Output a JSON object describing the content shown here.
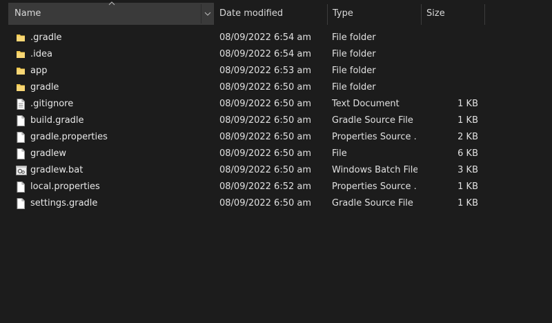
{
  "header": {
    "name": "Name",
    "date_modified": "Date modified",
    "type": "Type",
    "size": "Size"
  },
  "files": [
    {
      "name": ".gradle",
      "date": "08/09/2022 6:54 am",
      "type": "File folder",
      "size": "",
      "icon": "folder-icon"
    },
    {
      "name": ".idea",
      "date": "08/09/2022 6:54 am",
      "type": "File folder",
      "size": "",
      "icon": "folder-icon"
    },
    {
      "name": "app",
      "date": "08/09/2022 6:53 am",
      "type": "File folder",
      "size": "",
      "icon": "folder-icon"
    },
    {
      "name": "gradle",
      "date": "08/09/2022 6:50 am",
      "type": "File folder",
      "size": "",
      "icon": "folder-icon"
    },
    {
      "name": ".gitignore",
      "date": "08/09/2022 6:50 am",
      "type": "Text Document",
      "size": "1 KB",
      "icon": "text-file-icon"
    },
    {
      "name": "build.gradle",
      "date": "08/09/2022 6:50 am",
      "type": "Gradle Source File",
      "size": "1 KB",
      "icon": "file-icon"
    },
    {
      "name": "gradle.properties",
      "date": "08/09/2022 6:50 am",
      "type": "Properties Source ...",
      "size": "2 KB",
      "icon": "file-icon"
    },
    {
      "name": "gradlew",
      "date": "08/09/2022 6:50 am",
      "type": "File",
      "size": "6 KB",
      "icon": "file-icon"
    },
    {
      "name": "gradlew.bat",
      "date": "08/09/2022 6:50 am",
      "type": "Windows Batch File",
      "size": "3 KB",
      "icon": "batch-file-icon"
    },
    {
      "name": "local.properties",
      "date": "08/09/2022 6:52 am",
      "type": "Properties Source ...",
      "size": "1 KB",
      "icon": "file-icon"
    },
    {
      "name": "settings.gradle",
      "date": "08/09/2022 6:50 am",
      "type": "Gradle Source File",
      "size": "1 KB",
      "icon": "file-icon"
    }
  ],
  "colors": {
    "background": "#1c1c1c",
    "header_selected": "#3a3a3a",
    "folder": "#f2c94c",
    "text": "#e6e6e6"
  }
}
